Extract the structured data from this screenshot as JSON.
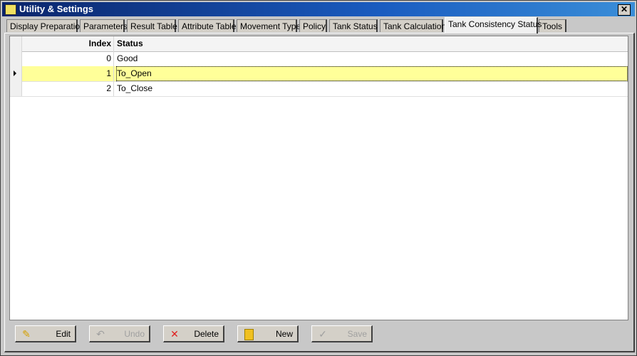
{
  "window": {
    "title": "Utility & Settings"
  },
  "tabs": [
    {
      "label": "Display Preparation"
    },
    {
      "label": "Parameters"
    },
    {
      "label": "Result Table"
    },
    {
      "label": "Attribute Table"
    },
    {
      "label": "Movement Type"
    },
    {
      "label": "Policy"
    },
    {
      "label": "Tank Status"
    },
    {
      "label": "Tank Calculation"
    },
    {
      "label": "Tank Consistency Status",
      "selected": true
    },
    {
      "label": "Tools"
    }
  ],
  "grid": {
    "columns": [
      "Index",
      "Status"
    ],
    "rows": [
      {
        "index": "0",
        "status": "Good"
      },
      {
        "index": "1",
        "status": "To_Open",
        "selected": true
      },
      {
        "index": "2",
        "status": "To_Close"
      }
    ],
    "selected_color": "#ffff99"
  },
  "buttons": {
    "edit": "Edit",
    "undo": "Undo",
    "delete": "Delete",
    "new": "New",
    "save": "Save"
  }
}
